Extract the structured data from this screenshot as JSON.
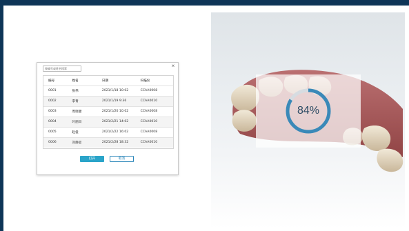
{
  "dialog": {
    "search_placeholder": "按编号或姓名搜索",
    "close_symbol": "×",
    "columns": [
      "编号",
      "姓名",
      "日期",
      "扫描仪"
    ],
    "rows": [
      {
        "id": "0001",
        "name": "张伟",
        "date": "2021/1/18  10:02",
        "scanner": "CCAA0008"
      },
      {
        "id": "0002",
        "name": "李青",
        "date": "2021/1/19   9:36",
        "scanner": "CCAA0010"
      },
      {
        "id": "0003",
        "name": "周晓健",
        "date": "2021/1/20  10:02",
        "scanner": "CCAA0008"
      },
      {
        "id": "0004",
        "name": "叶丽日",
        "date": "2021/2/21  14:02",
        "scanner": "CCAA0010"
      },
      {
        "id": "0005",
        "name": "赵俊",
        "date": "2021/2/22  16:02",
        "scanner": "CCAA0008"
      },
      {
        "id": "0006",
        "name": "刘静思",
        "date": "2021/2/28  18:32",
        "scanner": "CCAA0010"
      }
    ],
    "open_label": "打开",
    "cancel_label": "取消"
  },
  "scan": {
    "progress": 0.84,
    "progress_label": "84%"
  },
  "colors": {
    "frame": "#0e3557",
    "accent": "#2aa4c9",
    "ring_progress": "#3a89b8",
    "ring_track": "#d6dce1"
  }
}
